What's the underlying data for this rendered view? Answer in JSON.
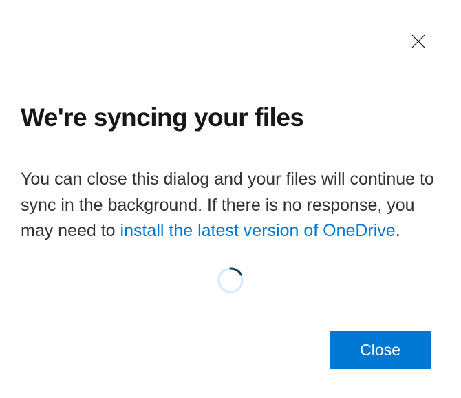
{
  "dialog": {
    "title": "We're syncing your files",
    "body_before_link": "You can close this dialog and your files will continue to sync in the background. If there is no response, you may need to ",
    "link_text": "install the latest version of OneDrive",
    "body_after_link": ".",
    "close_button": "Close"
  },
  "icons": {
    "close_x": "close-icon",
    "spinner": "loading-spinner"
  },
  "colors": {
    "primary": "#0078d4",
    "text": "#323130",
    "title": "#171717"
  }
}
